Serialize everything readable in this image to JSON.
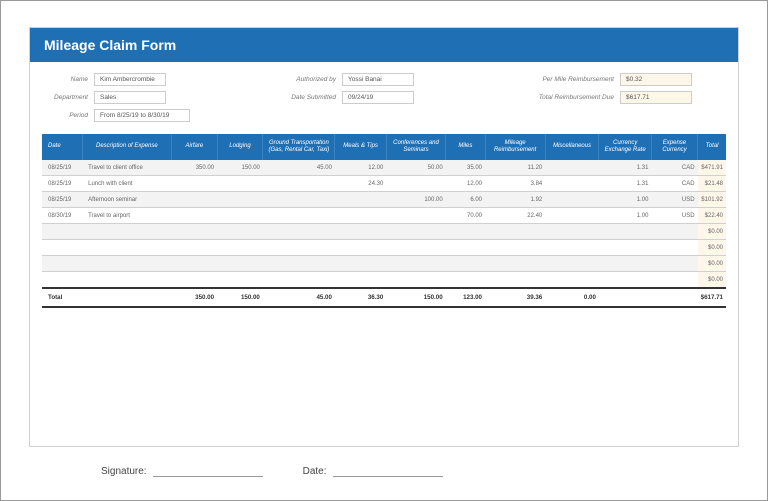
{
  "title": "Mileage Claim Form",
  "meta": {
    "name_label": "Name",
    "name_value": "Kim Ambercrombie",
    "department_label": "Department",
    "department_value": "Sales",
    "period_label": "Period",
    "period_value": "From 8/25/19 to 8/30/19",
    "auth_label": "Authorized by",
    "auth_value": "Yossi Banai",
    "submitted_label": "Date Submitted",
    "submitted_value": "09/24/19",
    "permile_label": "Per Mile Reimbursement",
    "permile_value": "$0.32",
    "totalreimb_label": "Total Reimbursement Due",
    "totalreimb_value": "$617.71"
  },
  "headers": {
    "date": "Date",
    "desc": "Description of Expense",
    "airfare": "Airfare",
    "lodging": "Lodging",
    "ground": "Ground Transportation (Gas, Rental Car, Taxi)",
    "meals": "Meals & Tips",
    "conf": "Conferences and Seminars",
    "miles": "Miles",
    "milere": "Mileage Reimbursement",
    "misc": "Miscellaneous",
    "rate": "Currency Exchange Rate",
    "curr": "Expense Currency",
    "total": "Total"
  },
  "rows": [
    {
      "date": "08/25/19",
      "desc": "Travel to client office",
      "airfare": "350.00",
      "lodging": "150.00",
      "ground": "45.00",
      "meals": "12.00",
      "conf": "50.00",
      "miles": "35.00",
      "milere": "11.20",
      "misc": "",
      "rate": "1.31",
      "curr": "CAD",
      "total": "$471.91"
    },
    {
      "date": "08/25/19",
      "desc": "Lunch with client",
      "airfare": "",
      "lodging": "",
      "ground": "",
      "meals": "24.30",
      "conf": "",
      "miles": "12.00",
      "milere": "3.84",
      "misc": "",
      "rate": "1.31",
      "curr": "CAD",
      "total": "$21.48"
    },
    {
      "date": "08/25/19",
      "desc": "Afternoon seminar",
      "airfare": "",
      "lodging": "",
      "ground": "",
      "meals": "",
      "conf": "100.00",
      "miles": "6.00",
      "milere": "1.92",
      "misc": "",
      "rate": "1.00",
      "curr": "USD",
      "total": "$101.92"
    },
    {
      "date": "08/30/19",
      "desc": "Travel to airport",
      "airfare": "",
      "lodging": "",
      "ground": "",
      "meals": "",
      "conf": "",
      "miles": "70.00",
      "milere": "22.40",
      "misc": "",
      "rate": "1.00",
      "curr": "USD",
      "total": "$22.40"
    },
    {
      "date": "",
      "desc": "",
      "airfare": "",
      "lodging": "",
      "ground": "",
      "meals": "",
      "conf": "",
      "miles": "",
      "milere": "",
      "misc": "",
      "rate": "",
      "curr": "",
      "total": "$0.00"
    },
    {
      "date": "",
      "desc": "",
      "airfare": "",
      "lodging": "",
      "ground": "",
      "meals": "",
      "conf": "",
      "miles": "",
      "milere": "",
      "misc": "",
      "rate": "",
      "curr": "",
      "total": "$0.00"
    },
    {
      "date": "",
      "desc": "",
      "airfare": "",
      "lodging": "",
      "ground": "",
      "meals": "",
      "conf": "",
      "miles": "",
      "milere": "",
      "misc": "",
      "rate": "",
      "curr": "",
      "total": "$0.00"
    },
    {
      "date": "",
      "desc": "",
      "airfare": "",
      "lodging": "",
      "ground": "",
      "meals": "",
      "conf": "",
      "miles": "",
      "milere": "",
      "misc": "",
      "rate": "",
      "curr": "",
      "total": "$0.00"
    }
  ],
  "totals": {
    "label": "Total",
    "airfare": "350.00",
    "lodging": "150.00",
    "ground": "45.00",
    "meals": "36.30",
    "conf": "150.00",
    "miles": "123.00",
    "milere": "39.36",
    "misc": "0.00",
    "total": "$617.71"
  },
  "sig": {
    "signature_label": "Signature:",
    "date_label": "Date:"
  }
}
